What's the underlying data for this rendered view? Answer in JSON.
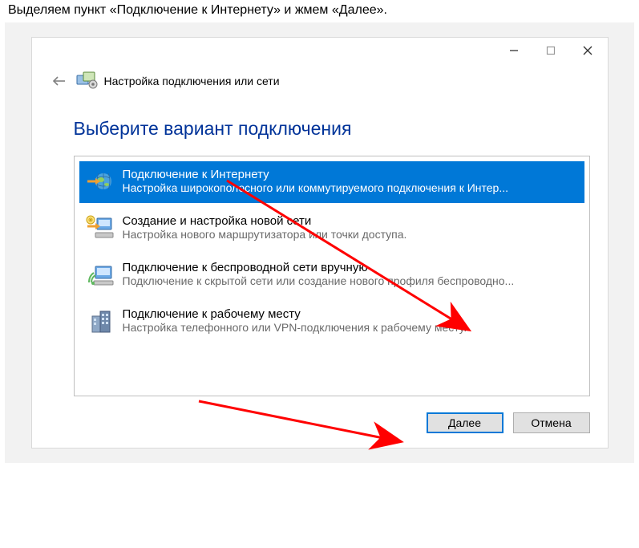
{
  "instruction": "Выделяем пункт «Подключение к Интернету» и жмем «Далее».",
  "wizardTitle": "Настройка подключения или сети",
  "heading": "Выберите вариант подключения",
  "options": [
    {
      "icon": "globe-icon",
      "title": "Подключение к Интернету",
      "desc": "Настройка широкополосного или коммутируемого подключения к Интер...",
      "selected": true
    },
    {
      "icon": "new-network-icon",
      "title": "Создание и настройка новой сети",
      "desc": "Настройка нового маршрутизатора или точки доступа."
    },
    {
      "icon": "wireless-icon",
      "title": "Подключение к беспроводной сети вручную",
      "desc": "Подключение к скрытой сети или создание нового профиля беспроводно..."
    },
    {
      "icon": "workplace-icon",
      "title": "Подключение к рабочему месту",
      "desc": "Настройка телефонного или VPN-подключения к рабочему месту."
    }
  ],
  "buttons": {
    "next": "Далее",
    "cancel": "Отмена"
  }
}
